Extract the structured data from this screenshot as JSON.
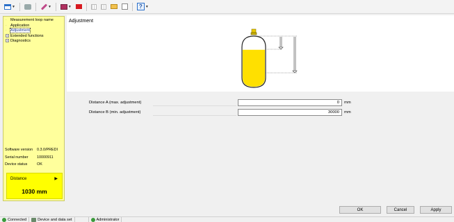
{
  "toolbar": {
    "items": [
      {
        "icon": "window-icon",
        "has_dropdown": true
      },
      {
        "icon": "print-icon",
        "has_dropdown": false
      },
      {
        "icon": "wrench-icon",
        "has_dropdown": true
      },
      {
        "icon": "device-screen-icon",
        "has_dropdown": true
      },
      {
        "icon": "record-icon",
        "has_dropdown": false
      },
      {
        "icon": "grid-icon",
        "has_dropdown": false
      },
      {
        "icon": "folder-icon",
        "has_dropdown": false
      },
      {
        "icon": "document-icon",
        "has_dropdown": false
      },
      {
        "icon": "help-icon",
        "has_dropdown": true
      }
    ],
    "help_glyph": "?"
  },
  "tree": {
    "items": [
      {
        "label": "Measurement loop name",
        "level": 0,
        "expandable": false
      },
      {
        "label": "Application",
        "level": 0,
        "expandable": false
      },
      {
        "label": "Adjustment",
        "level": 0,
        "expandable": false,
        "selected": true
      },
      {
        "label": "Extended functions",
        "level": 0,
        "expandable": true
      },
      {
        "label": "Diagnostics",
        "level": 0,
        "expandable": true
      }
    ]
  },
  "device_info": {
    "software_version_label": "Software version",
    "software_version_value": "0.3.0/PREDI",
    "serial_number_label": "Serial number",
    "serial_number_value": "10000911",
    "device_status_label": "Device status",
    "device_status_value": "OK"
  },
  "distance_box": {
    "label": "Distance",
    "value": "1030 mm"
  },
  "main": {
    "title": "Adjustment",
    "fields": [
      {
        "label": "Distance A (max. adjustment)",
        "value": "0",
        "unit": "mm"
      },
      {
        "label": "Distance B (min. adjustment)",
        "value": "30000",
        "unit": "mm"
      }
    ]
  },
  "buttons": {
    "ok": "OK",
    "cancel": "Cancel",
    "apply": "Apply"
  },
  "statusbar": {
    "connected": "Connected",
    "device_and_data_set": "Device and data set",
    "user": "Administrator"
  },
  "colors": {
    "panel_yellow": "#ffff9c",
    "distance_yellow": "#ffff00",
    "tank_fill": "#ffe000"
  }
}
